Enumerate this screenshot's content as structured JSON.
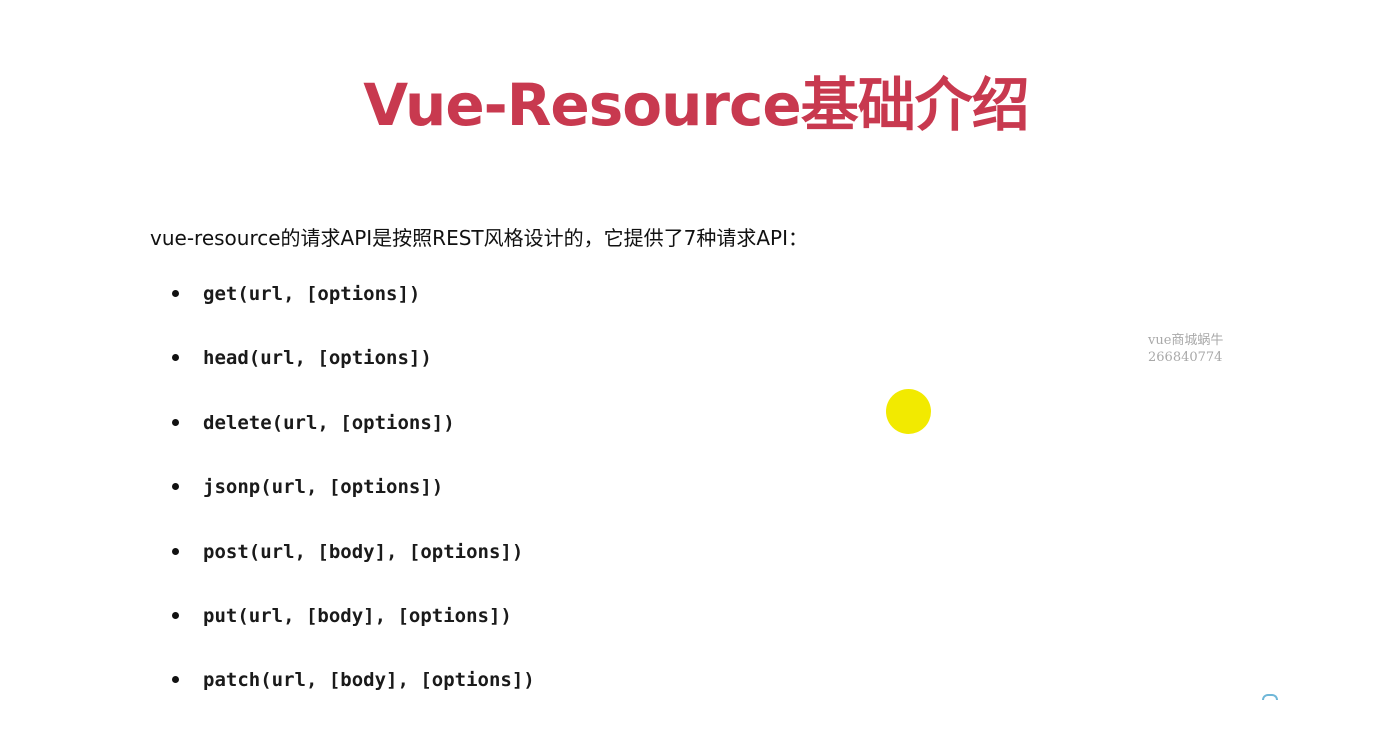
{
  "slide": {
    "title": "Vue-Resource基础介绍",
    "intro": "vue-resource的请求API是按照REST风格设计的，它提供了7种请求API：",
    "apis": [
      "get(url, [options])",
      "head(url, [options])",
      "delete(url, [options])",
      "jsonp(url, [options])",
      "post(url, [body], [options])",
      "put(url, [body], [options])",
      "patch(url, [body], [options])"
    ]
  },
  "watermark": {
    "line1": "vue商城蜗牛",
    "line2": "266840774"
  },
  "colors": {
    "title": "#c8394f",
    "text": "#111111",
    "cursor_highlight": "#f2ea00",
    "watermark": "#a9a9a9"
  }
}
